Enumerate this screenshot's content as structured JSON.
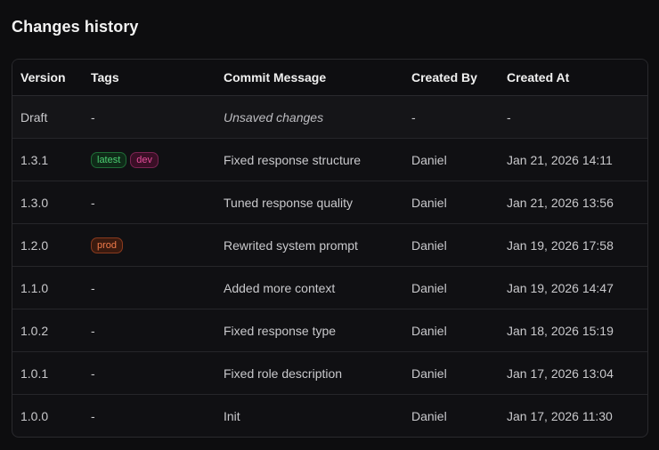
{
  "title": "Changes history",
  "columns": [
    "Version",
    "Tags",
    "Commit Message",
    "Created By",
    "Created At"
  ],
  "rows": [
    {
      "version": "Draft",
      "tags": [],
      "tags_empty": "-",
      "message": "Unsaved changes",
      "created_by": "-",
      "created_at": "-"
    },
    {
      "version": "1.3.1",
      "tags": [
        "latest",
        "dev"
      ],
      "tags_empty": "",
      "message": "Fixed response structure",
      "created_by": "Daniel",
      "created_at": "Jan 21, 2026 14:11"
    },
    {
      "version": "1.3.0",
      "tags": [],
      "tags_empty": "-",
      "message": "Tuned response quality",
      "created_by": "Daniel",
      "created_at": "Jan 21, 2026 13:56"
    },
    {
      "version": "1.2.0",
      "tags": [
        "prod"
      ],
      "tags_empty": "",
      "message": "Rewrited system prompt",
      "created_by": "Daniel",
      "created_at": "Jan 19, 2026 17:58"
    },
    {
      "version": "1.1.0",
      "tags": [],
      "tags_empty": "-",
      "message": "Added more context",
      "created_by": "Daniel",
      "created_at": "Jan 19, 2026 14:47"
    },
    {
      "version": "1.0.2",
      "tags": [],
      "tags_empty": "-",
      "message": "Fixed response type",
      "created_by": "Daniel",
      "created_at": "Jan 18, 2026 15:19"
    },
    {
      "version": "1.0.1",
      "tags": [],
      "tags_empty": "-",
      "message": "Fixed role description",
      "created_by": "Daniel",
      "created_at": "Jan 17, 2026 13:04"
    },
    {
      "version": "1.0.0",
      "tags": [],
      "tags_empty": "-",
      "message": "Init",
      "created_by": "Daniel",
      "created_at": "Jan 17, 2026 11:30"
    }
  ],
  "tag_colors": {
    "latest": "#4ccf72",
    "dev": "#e34d9a",
    "prod": "#f07a4a"
  }
}
